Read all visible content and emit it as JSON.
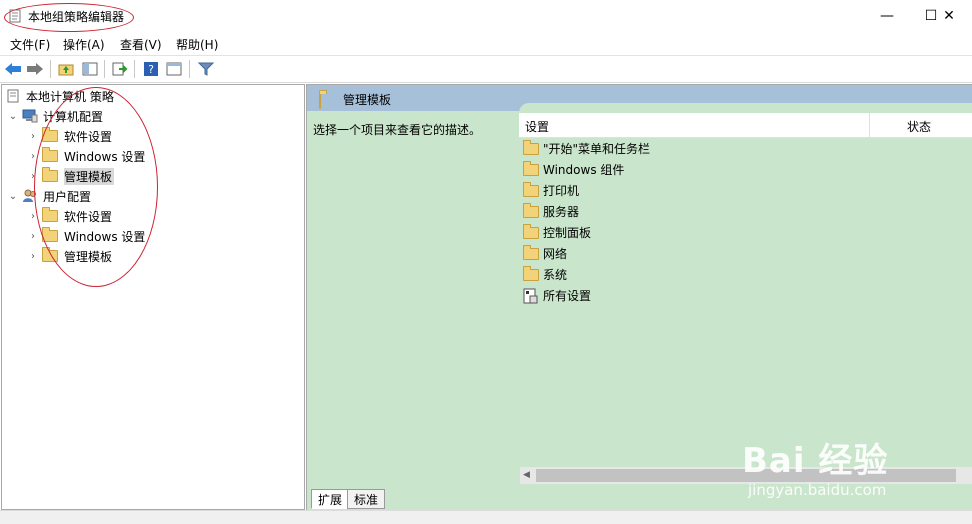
{
  "window": {
    "title": "本地组策略编辑器",
    "controls": {
      "minimize": "—",
      "maximize": "☐",
      "close": "✕"
    }
  },
  "menu": [
    "文件(F)",
    "操作(A)",
    "查看(V)",
    "帮助(H)"
  ],
  "tree": {
    "root": "本地计算机 策略",
    "computer": {
      "label": "计算机配置",
      "children": [
        "软件设置",
        "Windows 设置",
        "管理模板"
      ]
    },
    "user": {
      "label": "用户配置",
      "children": [
        "软件设置",
        "Windows 设置",
        "管理模板"
      ]
    }
  },
  "right": {
    "title": "管理模板",
    "description": "选择一个项目来查看它的描述。",
    "columns": [
      "设置",
      "状态"
    ],
    "items": [
      "\"开始\"菜单和任务栏",
      "Windows 组件",
      "打印机",
      "服务器",
      "控制面板",
      "网络",
      "系统",
      "所有设置"
    ]
  },
  "tabs": [
    "扩展",
    "标准"
  ],
  "watermark": {
    "brand": "Bai 经验",
    "url": "jingyan.baidu.com"
  },
  "colors": {
    "accent": "#cc2233",
    "pane": "#c9e5cb",
    "header": "#a7c0da"
  }
}
